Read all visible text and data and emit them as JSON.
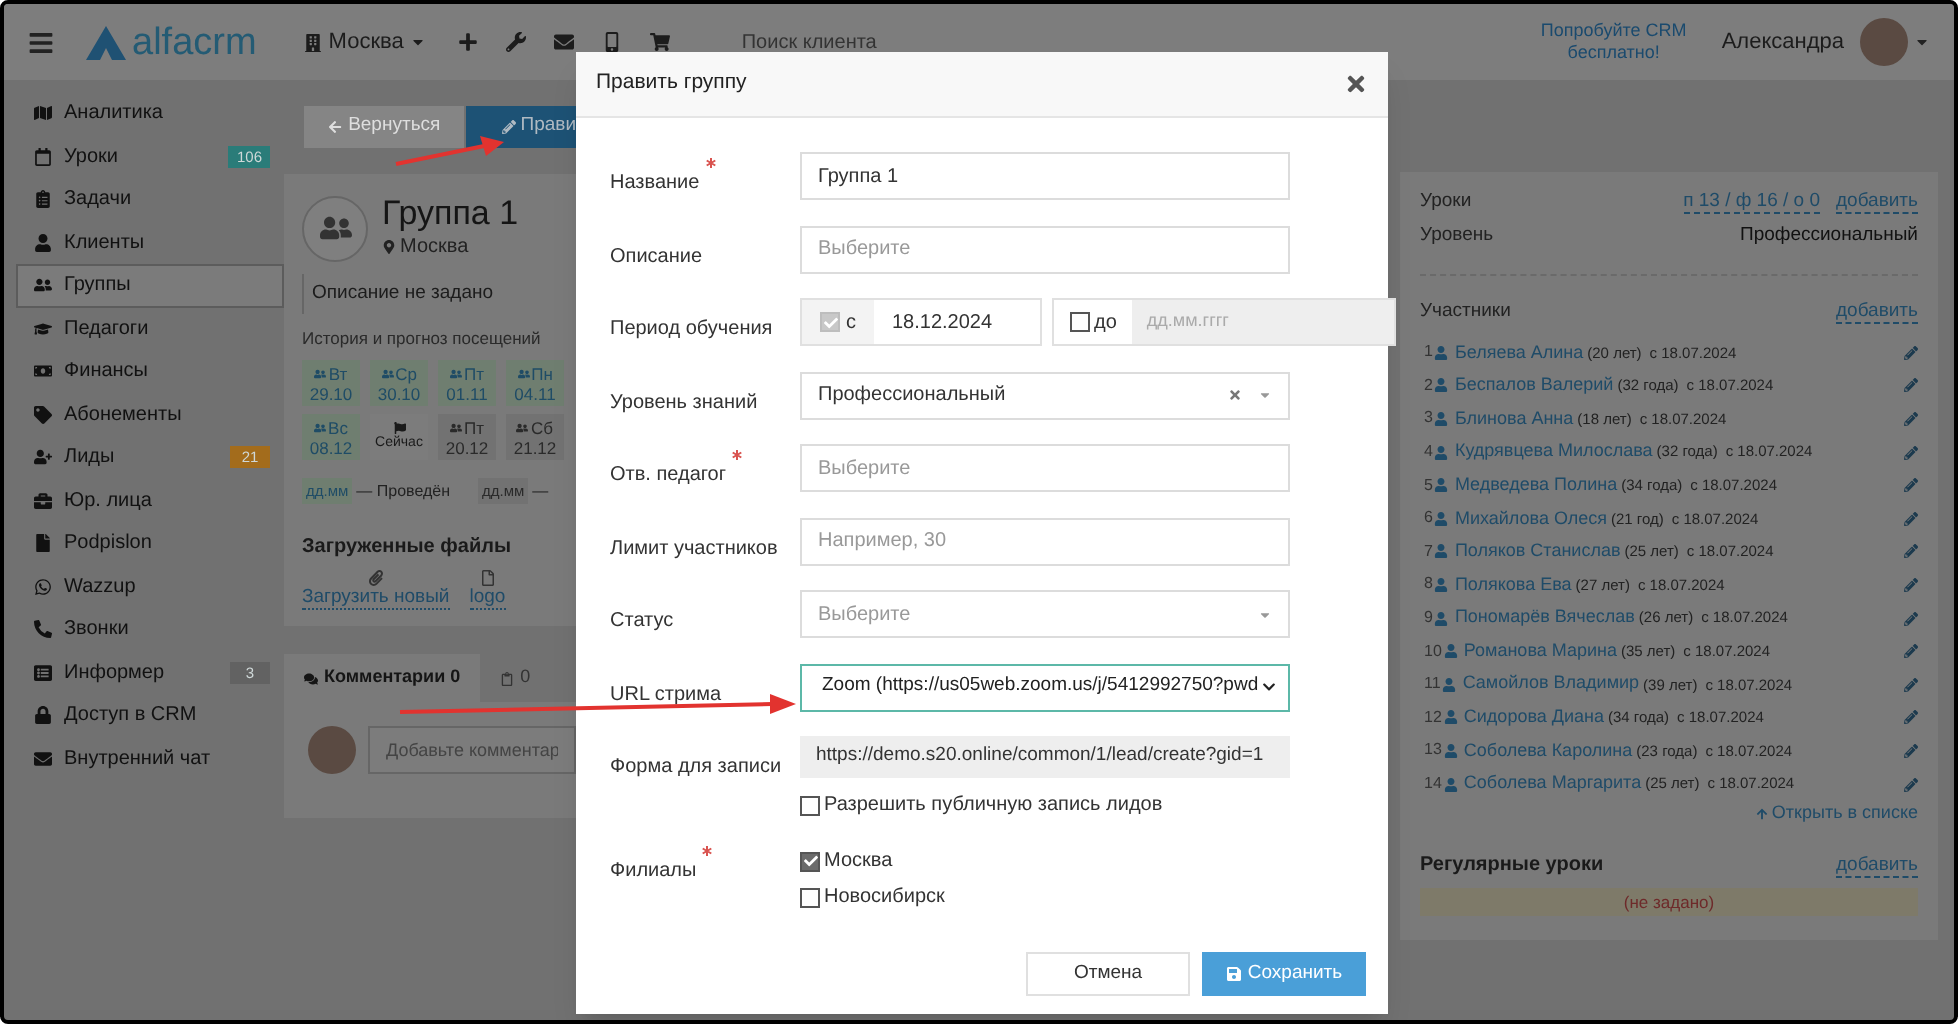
{
  "topbar": {
    "branch": "Москва",
    "search_placeholder": "Поиск клиента",
    "logo": "alfacrm",
    "promo": "Попробуйте CRM бесплатно!",
    "user": "Александра"
  },
  "sidebar": {
    "items": [
      {
        "label": "Аналитика",
        "selected": false
      },
      {
        "label": "Уроки",
        "selected": false,
        "badge": "106",
        "color": "#2a7c79"
      },
      {
        "label": "Задачи",
        "selected": false
      },
      {
        "label": "Клиенты",
        "selected": false
      },
      {
        "label": "Группы",
        "selected": true
      },
      {
        "label": "Педагоги",
        "selected": false
      },
      {
        "label": "Финансы",
        "selected": false
      },
      {
        "label": "Абонементы",
        "selected": false
      },
      {
        "label": "Лиды",
        "selected": false,
        "badge": "21",
        "color": "#a36c1c"
      },
      {
        "label": "Юр. лица",
        "selected": false
      },
      {
        "label": "Podpislon",
        "selected": false
      },
      {
        "label": "Wazzup",
        "selected": false
      },
      {
        "label": "Звонки",
        "selected": false
      },
      {
        "label": "Информер",
        "selected": false,
        "badge": "3",
        "color": "#626262"
      },
      {
        "label": "Доступ в CRM",
        "selected": false
      },
      {
        "label": "Внутренний чат",
        "selected": false
      }
    ]
  },
  "toolbar": {
    "back": "Вернуться",
    "edit": "Прави"
  },
  "group": {
    "title": "Группа 1",
    "branch": "Москва",
    "description": "Описание не задано",
    "history_title": "История и прогноз посещений",
    "visits": [
      {
        "kind": "past",
        "day": "Вт",
        "date": "29.10"
      },
      {
        "kind": "past",
        "day": "Ср",
        "date": "30.10"
      },
      {
        "kind": "past",
        "day": "Пт",
        "date": "01.11"
      },
      {
        "kind": "past",
        "day": "Пн",
        "date": "04.11"
      },
      {
        "kind": "past",
        "day": "Вс",
        "date": "08.12"
      },
      {
        "kind": "now",
        "label": "Сейчас"
      },
      {
        "kind": "future",
        "day": "Пт",
        "date": "20.12"
      },
      {
        "kind": "future",
        "day": "Сб",
        "date": "21.12"
      }
    ],
    "legend": [
      {
        "kind": "past",
        "sample": "дд.мм",
        "text": "— Проведён"
      },
      {
        "kind": "future",
        "sample": "дд.мм",
        "text": "—"
      }
    ],
    "files_title": "Загруженные файлы",
    "files": [
      {
        "kind": "upload",
        "label": "Загрузить новый"
      },
      {
        "kind": "file",
        "label": "logo"
      }
    ]
  },
  "comments": {
    "tabs": [
      {
        "label": "Комментарии 0",
        "selected": true
      },
      {
        "label": "0",
        "selected": false
      }
    ],
    "placeholder": "Добавьте комментар"
  },
  "right_panel": {
    "lessons_label": "Уроки",
    "lessons_stats": "п 13 / ф 16 / о 0",
    "lessons_add": "добавить",
    "level_label": "Уровень",
    "level_value": "Профессиональный",
    "participants_title": "Участники",
    "participants_add": "добавить",
    "participants": [
      {
        "num": "1",
        "name": "Беляева Алина",
        "age": "(20 лет)",
        "since": "с 18.07.2024"
      },
      {
        "num": "2",
        "name": "Беспалов Валерий",
        "age": "(32 года)",
        "since": "с 18.07.2024"
      },
      {
        "num": "3",
        "name": "Блинова Анна",
        "age": "(18 лет)",
        "since": "с 18.07.2024"
      },
      {
        "num": "4",
        "name": "Кудрявцева Милослава",
        "age": "(32 года)",
        "since": "с 18.07.2024"
      },
      {
        "num": "5",
        "name": "Медведева Полина",
        "age": "(34 года)",
        "since": "с 18.07.2024"
      },
      {
        "num": "6",
        "name": "Михайлова Олеся",
        "age": "(21 год)",
        "since": "с 18.07.2024"
      },
      {
        "num": "7",
        "name": "Поляков Станислав",
        "age": "(25 лет)",
        "since": "с 18.07.2024"
      },
      {
        "num": "8",
        "name": "Полякова Ева",
        "age": "(27 лет)",
        "since": "с 18.07.2024"
      },
      {
        "num": "9",
        "name": "Пономарёв Вячеслав",
        "age": "(26 лет)",
        "since": "с 18.07.2024"
      },
      {
        "num": "10",
        "name": "Романова Марина",
        "age": "(35 лет)",
        "since": "с 18.07.2024"
      },
      {
        "num": "11",
        "name": "Самойлов Владимир",
        "age": "(39 лет)",
        "since": "с 18.07.2024"
      },
      {
        "num": "12",
        "name": "Сидорова Диана",
        "age": "(34 года)",
        "since": "с 18.07.2024"
      },
      {
        "num": "13",
        "name": "Соболева Каролина",
        "age": "(23 года)",
        "since": "с 18.07.2024"
      },
      {
        "num": "14",
        "name": "Соболева Маргарита",
        "age": "(25 лет)",
        "since": "с 18.07.2024"
      }
    ],
    "open_list": "Открыть в списке",
    "regular_title": "Регулярные уроки",
    "regular_add": "добавить",
    "regular_empty": "(не задано)"
  },
  "modal": {
    "title": "Править группу",
    "fields": [
      {
        "kind": "text",
        "label": "Название",
        "required": true,
        "value": "Группа 1"
      },
      {
        "kind": "text",
        "label": "Описание",
        "required": false,
        "placeholder": "Выберите"
      },
      {
        "kind": "period",
        "label": "Период обучения",
        "required": false,
        "from": {
          "label": "с",
          "checked": true,
          "disabled": true,
          "value": "18.12.2024"
        },
        "to": {
          "label": "до",
          "checked": false,
          "disabled": true,
          "placeholder": "дд.мм.гггг"
        }
      },
      {
        "kind": "select",
        "label": "Уровень знаний",
        "required": false,
        "value": "Профессиональный",
        "clearable": true
      },
      {
        "kind": "text",
        "label": "Отв. педагог",
        "required": true,
        "placeholder": "Выберите"
      },
      {
        "kind": "text",
        "label": "Лимит участников",
        "required": false,
        "placeholder": "Например, 30"
      },
      {
        "kind": "select",
        "label": "Статус",
        "required": false,
        "placeholder": "Выберите",
        "clearable": false
      },
      {
        "kind": "native_select",
        "label": "URL стрима",
        "required": false,
        "value": "Zoom (https://us05web.zoom.us/j/5412992750?pwd",
        "focused": true
      },
      {
        "kind": "readonly",
        "label": "Форма для записи",
        "required": false,
        "value": "https://demo.s20.online/common/1/lead/create?gid=1",
        "option": {
          "label": "Разрешить публичную запись лидов",
          "checked": false
        }
      },
      {
        "kind": "checklist",
        "label": "Филиалы",
        "required": true,
        "options": [
          {
            "label": "Москва",
            "checked": true
          },
          {
            "label": "Новосибирск",
            "checked": false
          }
        ]
      }
    ],
    "buttons": [
      {
        "kind": "secondary",
        "label": "Отмена"
      },
      {
        "kind": "primary",
        "label": "Сохранить"
      }
    ]
  }
}
